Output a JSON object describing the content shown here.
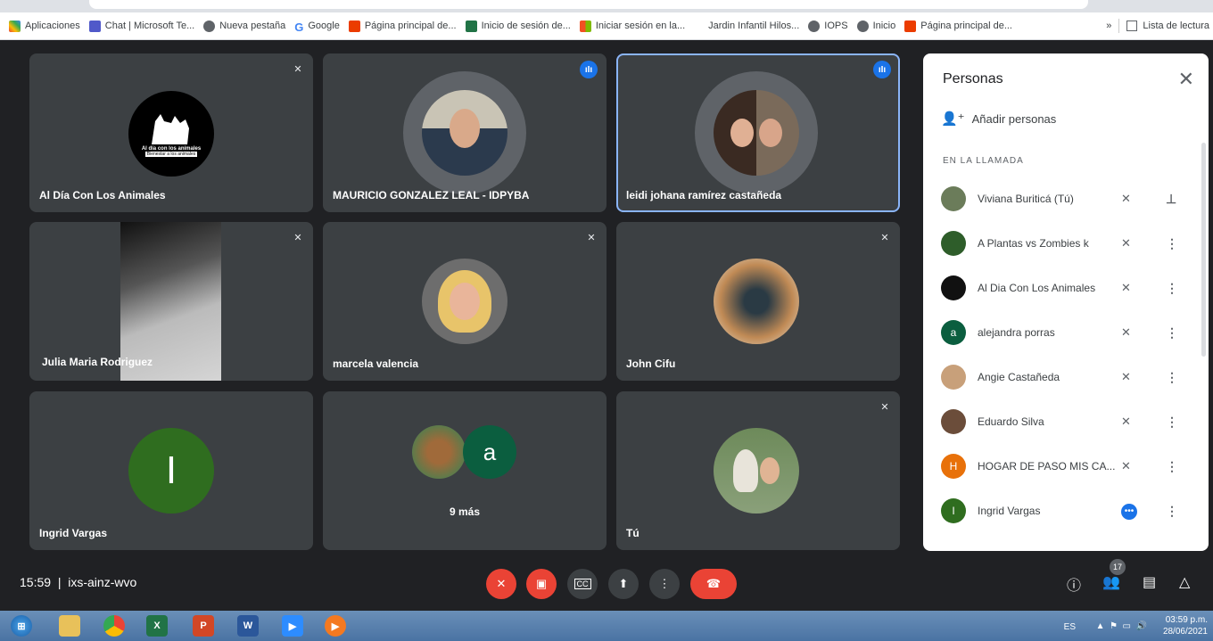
{
  "bookmarks": [
    {
      "label": "Aplicaciones",
      "color": "#ea4335"
    },
    {
      "label": "Chat | Microsoft Te...",
      "color": "#5059c9"
    },
    {
      "label": "Nueva pestaña",
      "color": "#5f6368"
    },
    {
      "label": "Google",
      "color": "#4285f4"
    },
    {
      "label": "Página principal de...",
      "color": "#eb3c00"
    },
    {
      "label": "Inicio de sesión de...",
      "color": "#217346"
    },
    {
      "label": "Iniciar sesión en la...",
      "color": "#f25022"
    },
    {
      "label": "Jardin Infantil Hilos...",
      "color": "#ffffff"
    },
    {
      "label": "IOPS",
      "color": "#5f6368"
    },
    {
      "label": "Inicio",
      "color": "#5f6368"
    },
    {
      "label": "Página principal de...",
      "color": "#eb3c00"
    }
  ],
  "bookmarks_more": "»",
  "reading_list": "Lista de lectura",
  "tiles": [
    {
      "name": "Al Día Con Los Animales",
      "logo_text": "Al día con los animales",
      "logo_sub": "Bienestar a los animales"
    },
    {
      "name": "MAURICIO GONZALEZ LEAL - IDPYBA"
    },
    {
      "name": "leidi johana ramírez castañeda"
    },
    {
      "name": "Julia Maria Rodriguez"
    },
    {
      "name": "marcela valencia"
    },
    {
      "name": "John Cifu"
    },
    {
      "name": "Ingrid Vargas",
      "initial": "I"
    },
    {
      "more": "9 más",
      "initial": "a"
    },
    {
      "name": "Tú"
    }
  ],
  "panel": {
    "title": "Personas",
    "add_label": "Añadir personas",
    "section": "EN LA LLAMADA",
    "people": [
      {
        "name": "Viviana Buriticá (Tú)",
        "color": "#6b7c5a",
        "initial": ""
      },
      {
        "name": "A Plantas vs Zombies k",
        "color": "#2e5d2a",
        "initial": ""
      },
      {
        "name": "Al Dia Con Los Animales",
        "color": "#111111",
        "initial": ""
      },
      {
        "name": "alejandra porras",
        "color": "#0b5e3f",
        "initial": "a"
      },
      {
        "name": "Angie Castañeda",
        "color": "#c8a07a",
        "initial": ""
      },
      {
        "name": "Eduardo Silva",
        "color": "#6b4d3a",
        "initial": ""
      },
      {
        "name": "HOGAR DE PASO MIS CA...",
        "color": "#e8710a",
        "initial": "H"
      },
      {
        "name": "Ingrid Vargas",
        "color": "#2f6d1f",
        "initial": "I"
      }
    ]
  },
  "meeting": {
    "time": "15:59",
    "code": "ixs-ainz-wvo",
    "people_count": "17"
  },
  "tray": {
    "lang": "ES",
    "time": "03:59 p.m.",
    "date": "28/06/2021"
  }
}
